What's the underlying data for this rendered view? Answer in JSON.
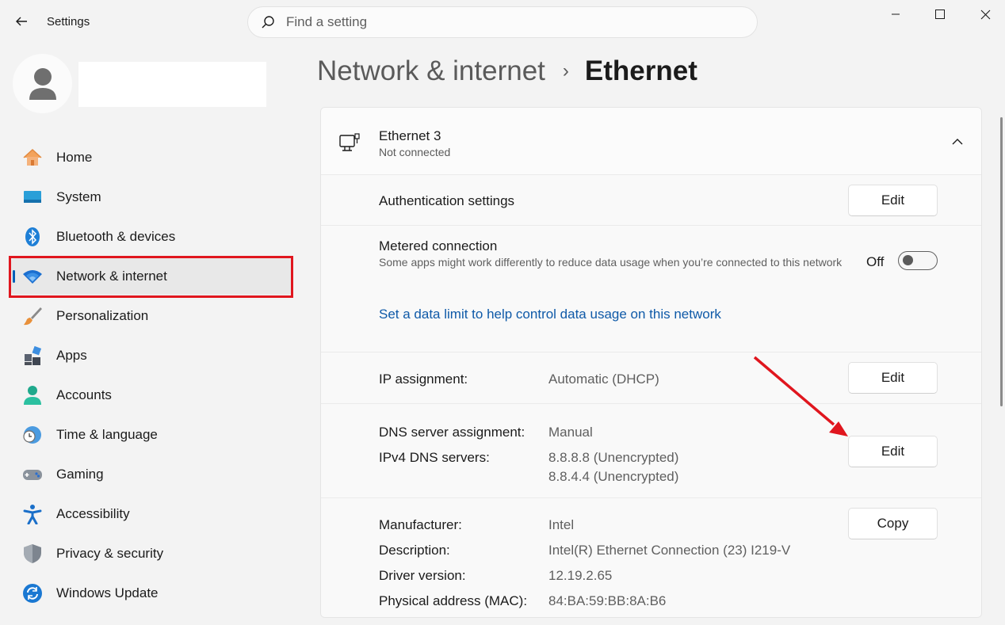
{
  "window": {
    "app_title": "Settings",
    "search_placeholder": "Find a setting"
  },
  "sidebar": {
    "items": [
      {
        "label": "Home",
        "icon": "home-icon"
      },
      {
        "label": "System",
        "icon": "system-icon"
      },
      {
        "label": "Bluetooth & devices",
        "icon": "bluetooth-icon"
      },
      {
        "label": "Network & internet",
        "icon": "wifi-icon",
        "active": true
      },
      {
        "label": "Personalization",
        "icon": "brush-icon"
      },
      {
        "label": "Apps",
        "icon": "apps-icon"
      },
      {
        "label": "Accounts",
        "icon": "accounts-icon"
      },
      {
        "label": "Time & language",
        "icon": "clock-globe-icon"
      },
      {
        "label": "Gaming",
        "icon": "gamepad-icon"
      },
      {
        "label": "Accessibility",
        "icon": "accessibility-icon"
      },
      {
        "label": "Privacy & security",
        "icon": "shield-icon"
      },
      {
        "label": "Windows Update",
        "icon": "update-icon"
      }
    ]
  },
  "breadcrumb": {
    "parent": "Network & internet",
    "separator": "›",
    "current": "Ethernet"
  },
  "ethernet": {
    "name": "Ethernet 3",
    "status": "Not connected",
    "authentication": {
      "label": "Authentication settings",
      "button": "Edit"
    },
    "metered": {
      "label": "Metered connection",
      "description": "Some apps might work differently to reduce data usage when you’re connected to this network",
      "toggle_text": "Off",
      "toggle_on": false
    },
    "data_limit_link": "Set a data limit to help control data usage on this network",
    "ip": {
      "label": "IP assignment:",
      "value": "Automatic (DHCP)",
      "button": "Edit"
    },
    "dns": {
      "label": "DNS server assignment:",
      "value": "Manual",
      "servers_label": "IPv4 DNS servers:",
      "server1": "8.8.8.8 (Unencrypted)",
      "server2": "8.8.4.4 (Unencrypted)",
      "button": "Edit"
    },
    "properties": {
      "manufacturer_label": "Manufacturer:",
      "manufacturer": "Intel",
      "description_label": "Description:",
      "description": "Intel(R) Ethernet Connection (23) I219-V",
      "driver_label": "Driver version:",
      "driver": "12.19.2.65",
      "mac_label": "Physical address (MAC):",
      "mac": "84:BA:59:BB:8A:B6",
      "button": "Copy"
    }
  },
  "colors": {
    "accent": "#005fb8",
    "annotation": "#e0161e",
    "link": "#0f5aa8"
  }
}
